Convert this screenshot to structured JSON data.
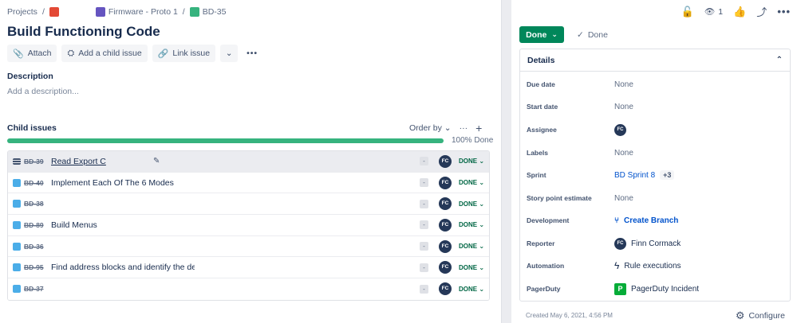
{
  "breadcrumb": {
    "projects": "Projects",
    "epic": "Firmware - Proto 1",
    "issue_key": "BD-35"
  },
  "issue": {
    "title": "Build Functioning Code"
  },
  "actions": {
    "attach": "Attach",
    "add_child": "Add a child issue",
    "link_issue": "Link issue"
  },
  "description": {
    "label": "Description",
    "placeholder": "Add a description..."
  },
  "child_issues": {
    "label": "Child issues",
    "order_by": "Order by",
    "progress_text": "100% Done",
    "progress_percent": 100,
    "items": [
      {
        "key": "BD-39",
        "summary": "Read Export C",
        "priority": "-",
        "assignee": "FC",
        "status": "DONE"
      },
      {
        "key": "BD-40",
        "summary": "Implement Each Of The 6 Modes",
        "priority": "-",
        "assignee": "FC",
        "status": "DONE"
      },
      {
        "key": "BD-38",
        "summary": "",
        "priority": "-",
        "assignee": "FC",
        "status": "DONE"
      },
      {
        "key": "BD-89",
        "summary": "Build Menus",
        "priority": "-",
        "assignee": "FC",
        "status": "DONE"
      },
      {
        "key": "BD-36",
        "summary": "",
        "priority": "-",
        "assignee": "FC",
        "status": "DONE"
      },
      {
        "key": "BD-95",
        "summary": "Find address blocks and identify the device",
        "priority": "-",
        "assignee": "FC",
        "status": "DONE"
      },
      {
        "key": "BD-37",
        "summary": "",
        "priority": "-",
        "assignee": "FC",
        "status": "DONE"
      }
    ]
  },
  "top": {
    "watch_count": "1"
  },
  "status": {
    "button": "Done",
    "transition": "Done"
  },
  "details": {
    "header": "Details",
    "due_date": {
      "label": "Due date",
      "value": "None"
    },
    "start_date": {
      "label": "Start date",
      "value": "None"
    },
    "assignee": {
      "label": "Assignee",
      "initials": "FC"
    },
    "labels": {
      "label": "Labels",
      "value": "None"
    },
    "sprint": {
      "label": "Sprint",
      "value": "BD Sprint 8",
      "extra": "+3"
    },
    "story_points": {
      "label": "Story point estimate",
      "value": "None"
    },
    "development": {
      "label": "Development",
      "value": "Create Branch"
    },
    "reporter": {
      "label": "Reporter",
      "initials": "FC",
      "name": "Finn Cormack"
    },
    "automation": {
      "label": "Automation",
      "value": "Rule executions"
    },
    "pagerduty": {
      "label": "PagerDuty",
      "value": "PagerDuty Incident"
    }
  },
  "footer": {
    "created": "Created May 6, 2021, 4:56 PM",
    "configure": "Configure"
  },
  "colors": {
    "done_green": "#00875a",
    "progress_green": "#36b37e",
    "link_blue": "#0052cc"
  }
}
